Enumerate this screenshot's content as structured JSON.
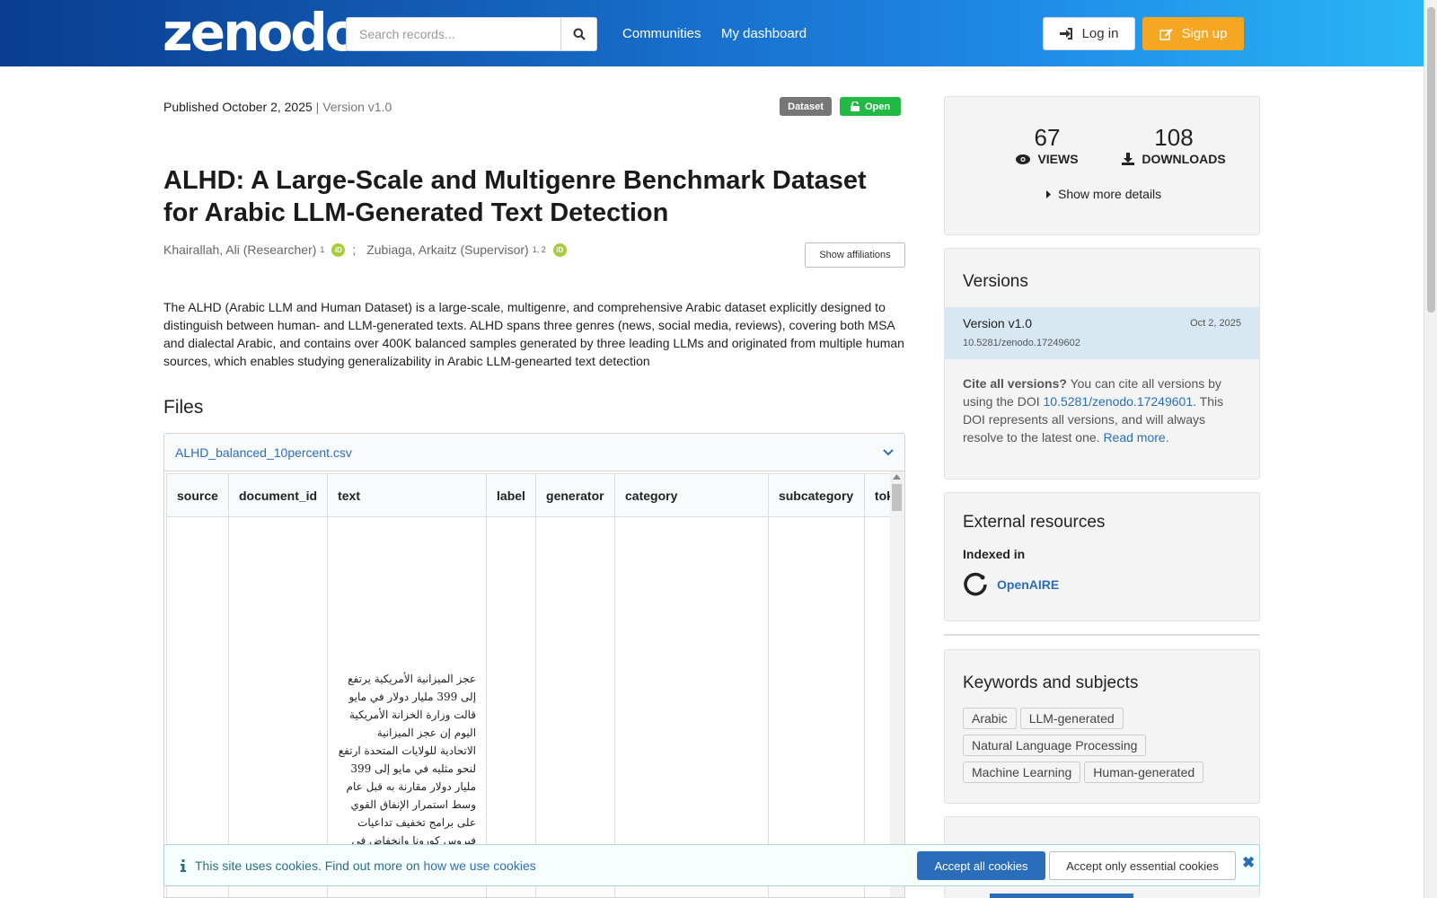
{
  "header": {
    "logo": "zenodo",
    "search_placeholder": "Search records...",
    "nav": [
      "Communities",
      "My dashboard"
    ],
    "login_label": "Log in",
    "signup_label": "Sign up"
  },
  "record": {
    "published": "Published October 2, 2025",
    "version": "| Version v1.0",
    "badges": [
      "Dataset",
      "Open"
    ],
    "title": "ALHD: A Large-Scale and Multigenre Benchmark Dataset for Arabic LLM-Generated Text Detection",
    "authors": [
      {
        "name": "Khairallah, Ali (Researcher)",
        "sup": "1"
      },
      {
        "name": "Zubiaga, Arkaitz (Supervisor)",
        "sup": "1, 2"
      }
    ],
    "separator": ";",
    "affiliations_button": "Show affiliations",
    "description": "The ALHD (Arabic LLM and Human Dataset) is a large-scale, multigenre, and comprehensive Arabic dataset explicitly designed to distinguish between human- and LLM-generated texts. ALHD spans three genres (news, social media, reviews), covering both MSA and dialectal Arabic, and contains over 400K balanced samples generated by three leading LLMs and originated from multiple human sources, which enables studying generalizability in Arabic LLM-genearted text detection"
  },
  "files": {
    "heading": "Files",
    "filename": "ALHD_balanced_10percent.csv",
    "columns": [
      "source",
      "document_id",
      "text",
      "label",
      "generator",
      "category",
      "subcategory",
      "tok"
    ],
    "first_text": "عجز الميزانية الأمريكية يرتفع إلى 399 مليار دولار في مايو قالت وزارة الخزانة الأمريكية اليوم إن عجز الميزانية الاتحادية للولايات المتحدة ارتفع لنحو مثليه في مايو إلى 399 مليار دولار مقارنة به قبل عام وسط استمرار الإنفاق القوي على برامج تخفيف تداعيات فيروس كورونا وانخفاض في"
  },
  "stats": {
    "views": "67",
    "views_label": "VIEWS",
    "downloads": "108",
    "downloads_label": "DOWNLOADS",
    "more_details": "Show more details"
  },
  "versions": {
    "heading": "Versions",
    "current": "Version v1.0",
    "date": "Oct 2, 2025",
    "doi": "10.5281/zenodo.17249602",
    "cite_bold": "Cite all versions?",
    "cite_text1": " You can cite all versions by using the DOI ",
    "cite_doi": "10.5281/zenodo.17249601",
    "cite_text2": ". This DOI represents all versions, and will always resolve to the latest one. ",
    "read_more": "Read more."
  },
  "external": {
    "heading": "External resources",
    "indexed": "Indexed in",
    "openaire": "OpenAIRE"
  },
  "keywords": {
    "heading": "Keywords and subjects",
    "items": [
      "Arabic",
      "LLM-generated",
      "Natural Language Processing",
      "Machine Learning",
      "Human-generated"
    ]
  },
  "cookie": {
    "text": "This site uses cookies. Find out more on ",
    "link": "how we use cookies",
    "accept_all": "Accept all cookies",
    "accept_essential": "Accept only essential cookies"
  },
  "colors": {
    "brand_blue": "#1565c0",
    "signup_orange": "#f5a623",
    "open_green": "#21ba45",
    "dataset_grey": "#767676"
  }
}
